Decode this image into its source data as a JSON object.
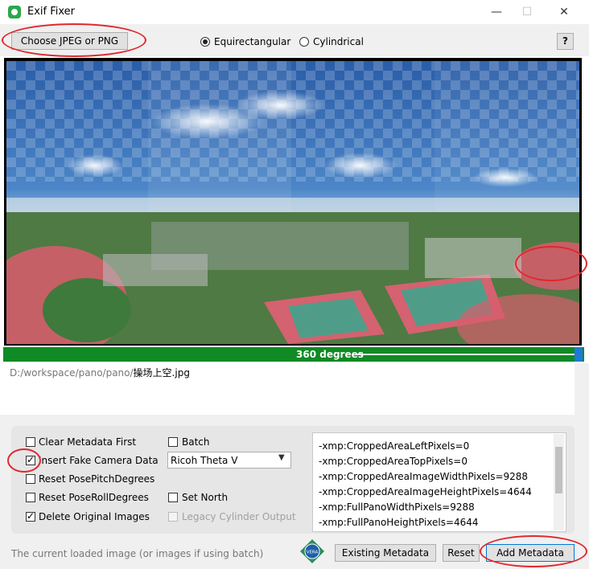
{
  "window": {
    "title": "Exif Fixer",
    "minimize": "—",
    "maximize": "☐",
    "close": "✕"
  },
  "toolbar": {
    "choose_label": "Choose JPEG or PNG",
    "projection_options": [
      "Equirectangular",
      "Cylindrical"
    ],
    "projection_selected": "Equirectangular",
    "help_label": "?"
  },
  "slider": {
    "label": "360 degrees",
    "value_fraction": 1.0
  },
  "file": {
    "path_prefix": "D:/workspace/pano/pano/",
    "filename": "操场上空.jpg"
  },
  "options": {
    "clear_metadata": {
      "label": "Clear Metadata First",
      "checked": false
    },
    "insert_fake_camera": {
      "label": "Insert Fake Camera Data",
      "checked": true
    },
    "reset_pitch": {
      "label": "Reset PosePitchDegrees",
      "checked": false
    },
    "reset_roll": {
      "label": "Reset PoseRollDegrees",
      "checked": false
    },
    "delete_originals": {
      "label": "Delete Original Images",
      "checked": true
    },
    "batch": {
      "label": "Batch",
      "checked": false
    },
    "camera_model": "Ricoh Theta V",
    "set_north": {
      "label": "Set North",
      "checked": false
    },
    "legacy_cylinder": {
      "label": "Legacy Cylinder Output",
      "checked": false,
      "disabled": true
    }
  },
  "metadata_lines": [
    "-xmp:CroppedAreaLeftPixels=0",
    "-xmp:CroppedAreaTopPixels=0",
    "-xmp:CroppedAreaImageWidthPixels=9288",
    "-xmp:CroppedAreaImageHeightPixels=4644",
    "-xmp:FullPanoWidthPixels=9288",
    "-xmp:FullPanoHeightPixels=4644"
  ],
  "status": "The current loaded image (or images if using batch)",
  "logo_text": "VERA",
  "buttons": {
    "existing": "Existing Metadata",
    "reset": "Reset",
    "add": "Add Metadata"
  },
  "colors": {
    "slider_green": "#108a24",
    "accent_blue": "#0078d7",
    "annotation_red": "#e0282e",
    "app_icon": "#2aa84a"
  }
}
